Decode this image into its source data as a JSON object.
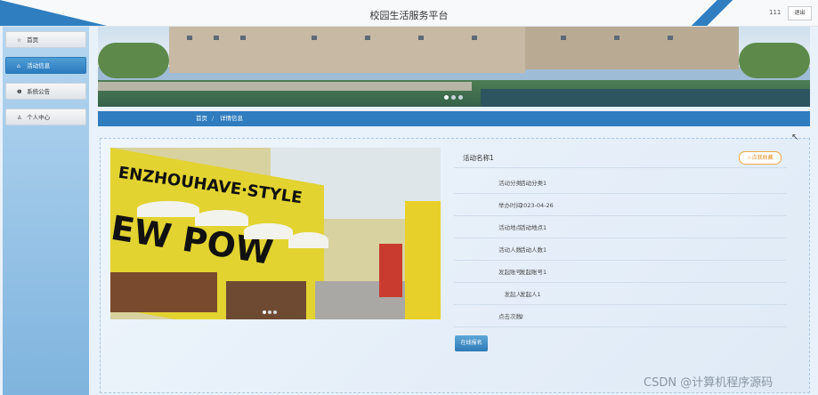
{
  "header": {
    "title": "校园生活服务平台",
    "user": "111",
    "logout_label": "退出"
  },
  "sidebar": {
    "items": [
      {
        "icon": "star-icon",
        "label": "首页",
        "active": false
      },
      {
        "icon": "home-icon",
        "label": "活动信息",
        "active": true
      },
      {
        "icon": "info-icon",
        "label": "系统公告",
        "active": false
      },
      {
        "icon": "user-icon",
        "label": "个人中心",
        "active": false
      }
    ]
  },
  "banner": {
    "slides": 3,
    "active_slide": 1
  },
  "breadcrumb": {
    "home": "首页",
    "separator": "/",
    "current": "详情信息"
  },
  "detail": {
    "name_label": "活动名称1",
    "favorite_label": "☆点我收藏",
    "fields": [
      {
        "key": "活动分类",
        "value": "活动分类1"
      },
      {
        "key": "举办时间",
        "value": "2023-04-26"
      },
      {
        "key": "活动地点",
        "value": "活动地点1"
      },
      {
        "key": "活动人数",
        "value": "活动人数1"
      },
      {
        "key": "发起账号",
        "value": "发起账号1"
      },
      {
        "key": "发起人",
        "value": "发起人1"
      },
      {
        "key": "点击次数",
        "value": "2"
      }
    ],
    "signup_label": "在线报名",
    "photo_slides": 3,
    "photo_active_slide": 1
  },
  "watermark": "CSDN @计算机程序源码",
  "colors": {
    "primary": "#2f7cbe",
    "accent": "#e58a1b"
  }
}
